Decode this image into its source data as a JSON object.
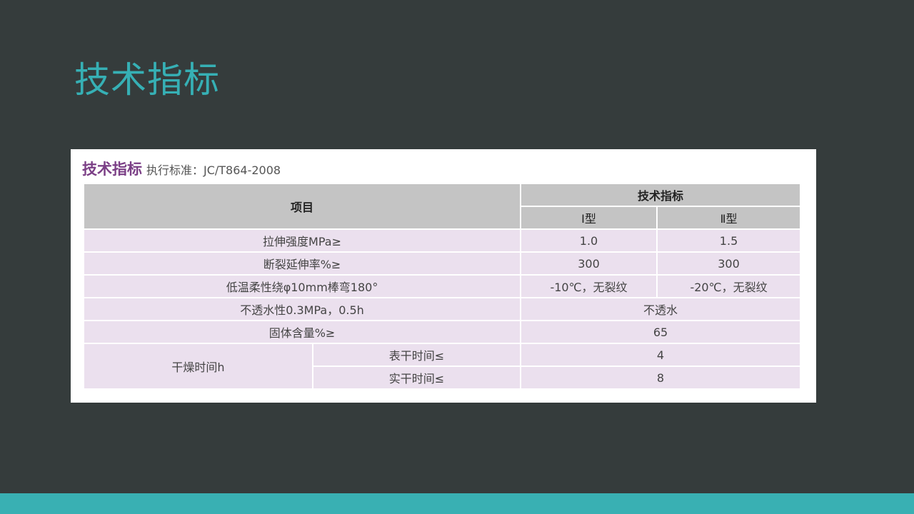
{
  "slide": {
    "title": "技术指标"
  },
  "panel": {
    "title": "技术指标",
    "subtitle": "执行标准：JC/T864-2008"
  },
  "table": {
    "header": {
      "item": "项目",
      "spec": "技术指标",
      "type1": "Ⅰ型",
      "type2": "Ⅱ型"
    },
    "rows": [
      {
        "item": "拉伸强度MPa≥",
        "type1": "1.0",
        "type2": "1.5"
      },
      {
        "item": "断裂延伸率%≥",
        "type1": "300",
        "type2": "300"
      },
      {
        "item": "低温柔性绕φ10mm棒弯180°",
        "type1": "-10℃，无裂纹",
        "type2": "-20℃，无裂纹"
      },
      {
        "item": "不透水性0.3MPa，0.5h",
        "value": "不透水"
      },
      {
        "item": "固体含量%≥",
        "value": "65"
      }
    ],
    "drying": {
      "item": "干燥时间h",
      "surface": {
        "label": "表干时间≤",
        "value": "4"
      },
      "solid": {
        "label": "实干时间≤",
        "value": "8"
      }
    }
  },
  "colors": {
    "background": "#353c3c",
    "title": "#36b0b5",
    "bottom_bar": "#39b0b3",
    "header_cell": "#c4c4c4",
    "body_cell": "#ebe0ee",
    "panel_title": "#7b3f86"
  }
}
